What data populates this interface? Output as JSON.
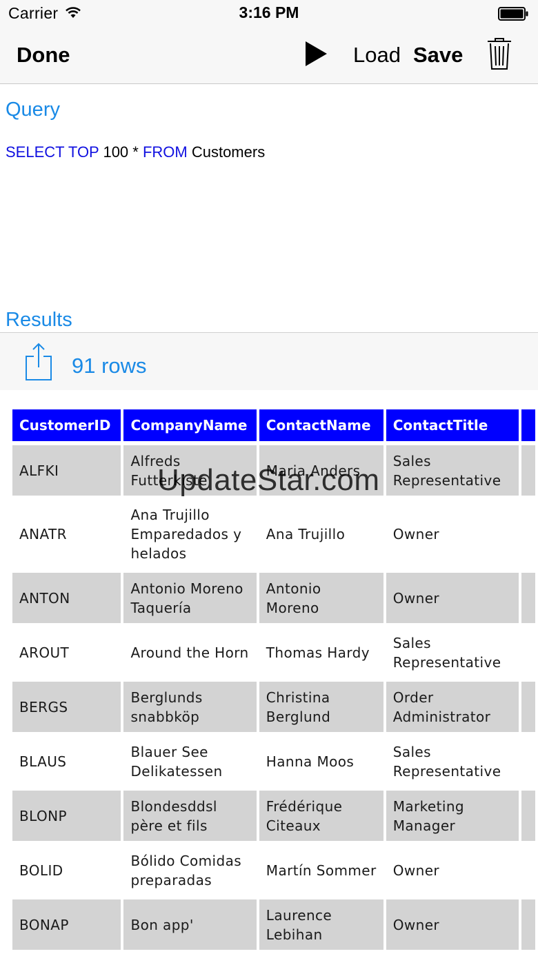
{
  "status_bar": {
    "carrier": "Carrier",
    "time": "3:16 PM"
  },
  "nav_bar": {
    "done_label": "Done",
    "play_icon": "play-icon",
    "load_label": "Load",
    "save_label": "Save",
    "trash_icon": "trash-icon"
  },
  "query": {
    "section_label": "Query",
    "kw_select_top": "SELECT TOP",
    "limit": " 100 * ",
    "kw_from": "FROM",
    "table": " Customers"
  },
  "results": {
    "section_label": "Results",
    "share_icon": "share-icon",
    "row_count": "91 rows",
    "columns": [
      "CustomerID",
      "CompanyName",
      "ContactName",
      "ContactTitle"
    ],
    "rows": [
      [
        "ALFKI",
        "Alfreds Futterkiste",
        "Maria Anders",
        "Sales Representative"
      ],
      [
        "ANATR",
        "Ana Trujillo Emparedados y helados",
        "Ana Trujillo",
        "Owner"
      ],
      [
        "ANTON",
        "Antonio Moreno Taquería",
        "Antonio Moreno",
        "Owner"
      ],
      [
        "AROUT",
        "Around the Horn",
        "Thomas Hardy",
        "Sales Representative"
      ],
      [
        "BERGS",
        "Berglunds snabbköp",
        "Christina Berglund",
        "Order Administrator"
      ],
      [
        "BLAUS",
        "Blauer See Delikatessen",
        "Hanna Moos",
        "Sales Representative"
      ],
      [
        "BLONP",
        "Blondesddsl père et fils",
        "Frédérique Citeaux",
        "Marketing Manager"
      ],
      [
        "BOLID",
        "Bólido Comidas preparadas",
        "Martín Sommer",
        "Owner"
      ],
      [
        "BONAP",
        "Bon app'",
        "Laurence Lebihan",
        "Owner"
      ]
    ]
  },
  "watermark": "UpdateStar.com",
  "colors": {
    "accent": "#1a8ae6",
    "header_bg": "#0000ff",
    "shaded_row": "#d3d3d3",
    "keyword": "#1010e0"
  }
}
